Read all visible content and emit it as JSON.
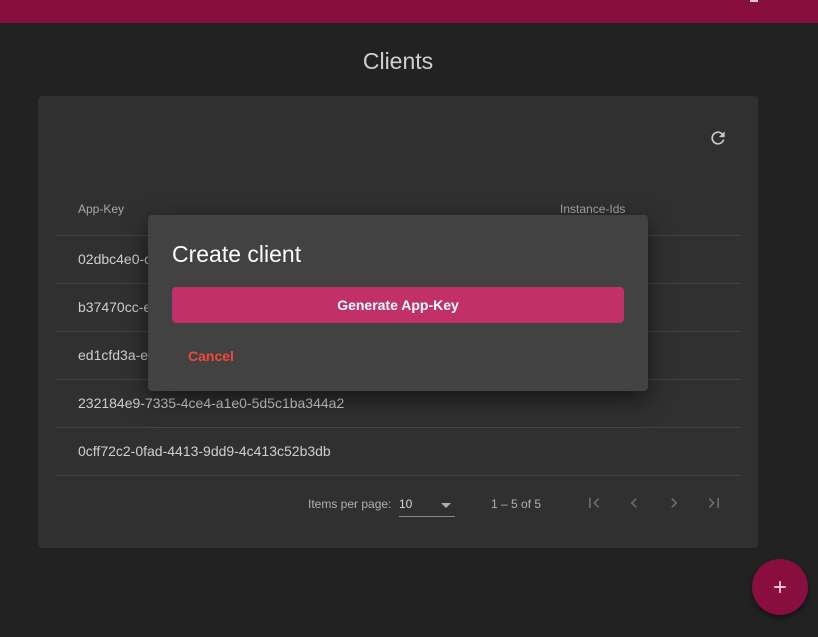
{
  "page": {
    "title": "Clients"
  },
  "table": {
    "headers": [
      "App-Key",
      "Instance-Ids"
    ],
    "rows": [
      "02dbc4e0-c",
      "b37470cc-e",
      "ed1cfd3a-e",
      "232184e9-7335-4ce4-a1e0-5d5c1ba344a2",
      "0cff72c2-0fad-4413-9dd9-4c413c52b3db"
    ]
  },
  "paginator": {
    "items_per_page_label": "Items per page:",
    "page_size": "10",
    "range_label": "1 – 5 of 5"
  },
  "dialog": {
    "title": "Create client",
    "generate_label": "Generate App-Key",
    "cancel_label": "Cancel"
  },
  "fab": {
    "label": "+"
  },
  "colors": {
    "accent": "#880e40",
    "primary_button": "#c2306a",
    "warn": "#f0483a"
  },
  "icons": {
    "refresh": "refresh-icon",
    "first_page": "first-page-icon",
    "prev_page": "chevron-left-icon",
    "next_page": "chevron-right-icon",
    "last_page": "last-page-icon",
    "add": "plus-icon"
  }
}
